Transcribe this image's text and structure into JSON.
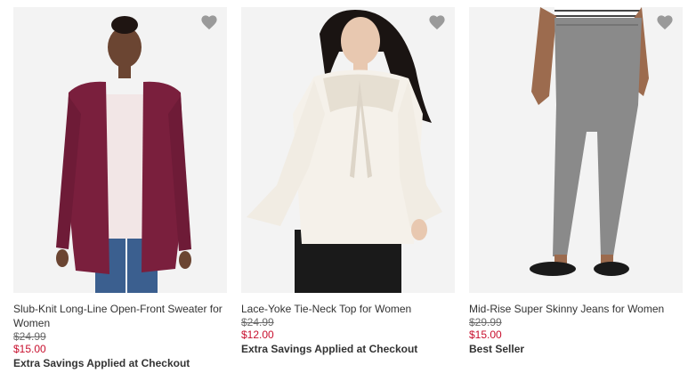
{
  "products": [
    {
      "name": "Slub-Knit Long-Line Open-Front Sweater for Women",
      "regular_price": "$24.99",
      "sale_price": "$15.00",
      "promo": "Extra Savings Applied at Checkout",
      "favorite_icon": "heart-icon",
      "image_colors": {
        "garment": "#7a1f3d",
        "inner": "#f2e6e6",
        "pants": "#3b5f8f",
        "skin": "#6b4532"
      }
    },
    {
      "name": "Lace-Yoke Tie-Neck Top for Women",
      "regular_price": "$24.99",
      "sale_price": "$12.00",
      "promo": "Extra Savings Applied at Checkout",
      "favorite_icon": "heart-icon",
      "image_colors": {
        "garment": "#f5f1ea",
        "pants": "#1a1a1a",
        "skin": "#e8c8b0",
        "hair": "#1a1412"
      }
    },
    {
      "name": "Mid-Rise Super Skinny Jeans for Women",
      "regular_price": "$29.99",
      "sale_price": "$15.00",
      "promo": "Best Seller",
      "favorite_icon": "heart-icon",
      "image_colors": {
        "garment": "#8a8a8a",
        "shoes": "#1a1a1a",
        "skin": "#9c6b4e"
      }
    }
  ],
  "colors": {
    "sale": "#c8102e",
    "regular": "#6b6b6b",
    "text": "#333333",
    "heart": "#9a9a9a"
  }
}
